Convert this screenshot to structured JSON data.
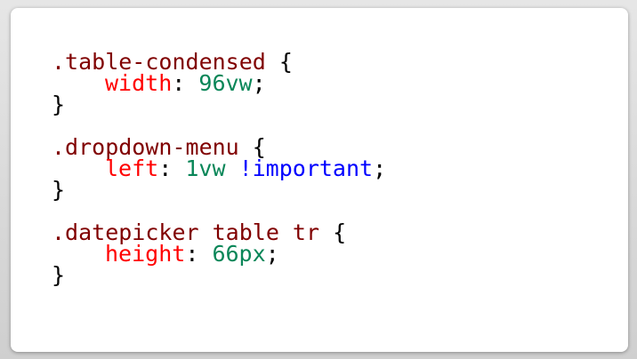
{
  "rules": [
    {
      "selector": ".table-condensed",
      "open": "{",
      "close": "}",
      "property": "width",
      "colon": ":",
      "value": "96vw",
      "important": "",
      "semicolon": ";"
    },
    {
      "selector": ".dropdown-menu",
      "open": "{",
      "close": "}",
      "property": "left",
      "colon": ":",
      "value": "1vw",
      "important": "!important",
      "semicolon": ";"
    },
    {
      "selector": ".datepicker table tr",
      "open": "{",
      "close": "}",
      "property": "height",
      "colon": ":",
      "value": "66px",
      "important": "",
      "semicolon": ";"
    }
  ],
  "colors": {
    "selector": "#800000",
    "property": "#ff0000",
    "value": "#098658",
    "keyword": "#0000ff"
  }
}
